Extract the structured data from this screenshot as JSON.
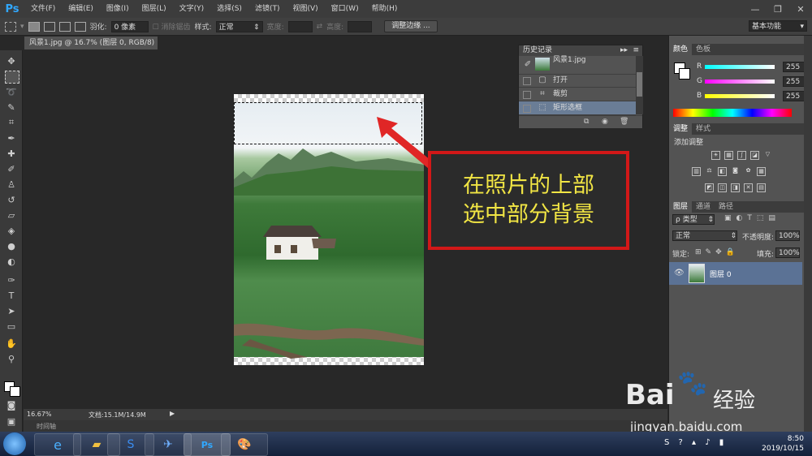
{
  "app": {
    "logo": "Ps"
  },
  "menu": [
    "文件(F)",
    "编辑(E)",
    "图像(I)",
    "图层(L)",
    "文字(Y)",
    "选择(S)",
    "滤镜(T)",
    "视图(V)",
    "窗口(W)",
    "帮助(H)"
  ],
  "options": {
    "feather_label": "羽化:",
    "feather_value": "0 像素",
    "antialias_label": "消除锯齿",
    "style_label": "样式:",
    "style_value": "正常",
    "width_label": "宽度:",
    "height_label": "高度:",
    "refine_edge": "调整边缘 ...",
    "workspace": "基本功能"
  },
  "document": {
    "tab_title": "风景1.jpg @ 16.7% (图层 0, RGB/8) *"
  },
  "callout": {
    "line1": "在照片的上部",
    "line2": "选中部分背景"
  },
  "history": {
    "title": "历史记录",
    "snapshot": "风景1.jpg",
    "items": [
      "打开",
      "裁剪",
      "矩形选框"
    ]
  },
  "color_panel": {
    "tabs": [
      "颜色",
      "色板"
    ],
    "r_label": "R",
    "g_label": "G",
    "b_label": "B",
    "r": "255",
    "g": "255",
    "b": "255"
  },
  "adjust_panel": {
    "tabs": [
      "调整",
      "样式"
    ],
    "title": "添加调整"
  },
  "layers_panel": {
    "tabs": [
      "图层",
      "通道",
      "路径"
    ],
    "kind": "ρ 类型",
    "blend": "正常",
    "opacity_label": "不透明度:",
    "opacity": "100%",
    "lock_label": "锁定:",
    "fill_label": "填充:",
    "fill": "100%",
    "layer_name": "图层 0"
  },
  "status": {
    "zoom": "16.67%",
    "doc": "文档:15.1M/14.9M",
    "timeline": "时间轴"
  },
  "taskbar": {
    "time": "8:50",
    "date": "2019/10/15"
  },
  "watermark": {
    "brand": "Bai",
    "brand2": "经验",
    "url": "jingyan.baidu.com"
  },
  "colors": {
    "callout_border": "#d21818",
    "callout_text": "#f1e544",
    "accent": "#31a8ff"
  }
}
